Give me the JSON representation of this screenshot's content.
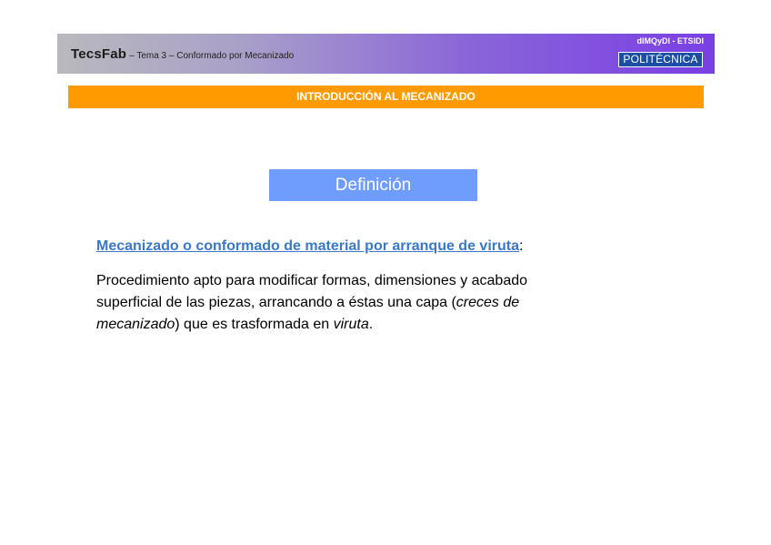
{
  "header": {
    "brand": "TecsFab",
    "subtitle": "– Tema 3 – Conformado por Mecanizado",
    "department": "dIMQyDI - ETSIDI",
    "logo_text": "POLITÉCNICA"
  },
  "section": {
    "title": "INTRODUCCIÓN AL MECANIZADO"
  },
  "definition_box": {
    "label": "Definición"
  },
  "content": {
    "term": "Mecanizado o conformado de material por arranque de viruta",
    "term_suffix": ":",
    "line1": "Procedimiento apto para modificar formas, dimensiones y acabado",
    "line2_a": "superficial de las piezas, arrancando a éstas una capa (",
    "line2_b": "creces de",
    "line3_a": "mecanizado",
    "line3_b": ") que es trasformada en ",
    "line3_c": "viruta",
    "line3_d": "."
  },
  "colors": {
    "section_bar": "#ff9a00",
    "definition_box": "#6f9dfd",
    "term_link": "#3a78c8",
    "logo_bg": "#1a4fa3"
  }
}
